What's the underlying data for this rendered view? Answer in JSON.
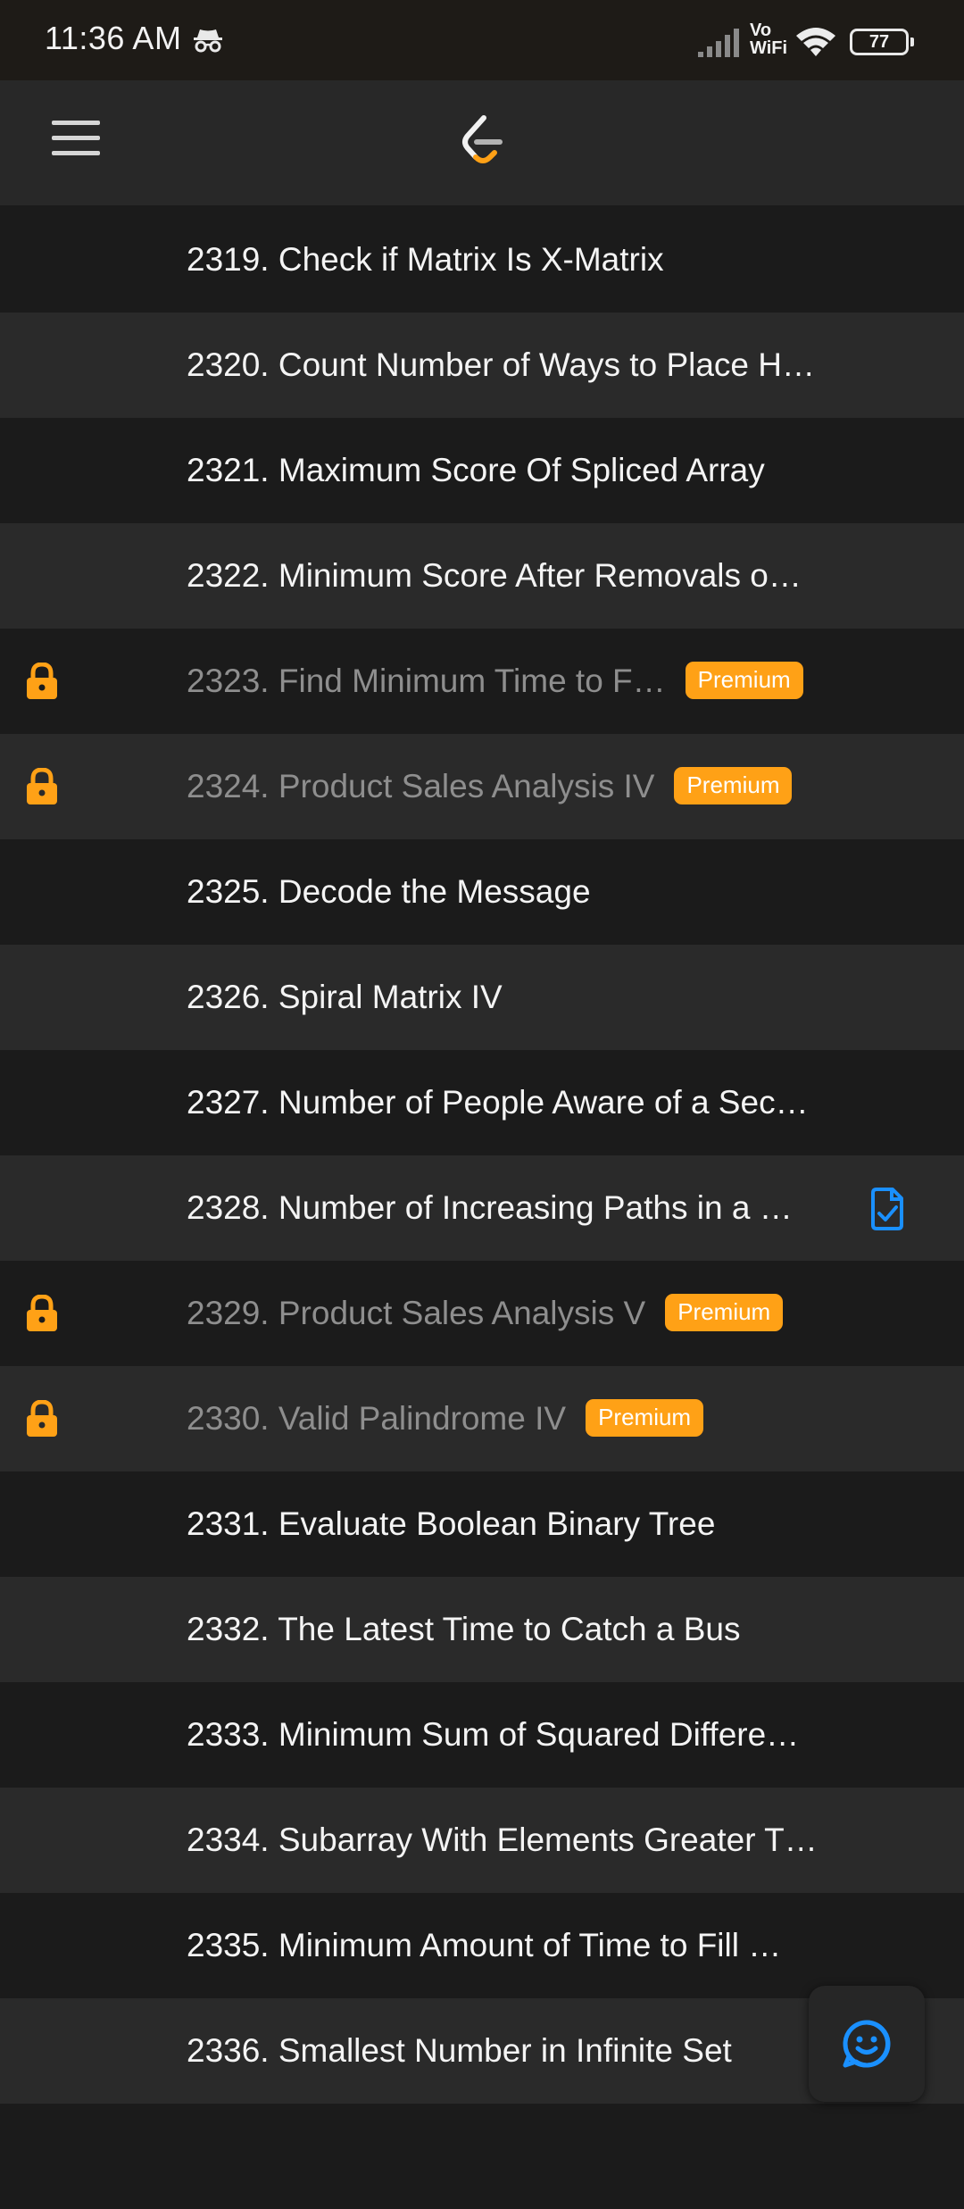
{
  "status_bar": {
    "time": "11:36 AM",
    "network_label_top": "Vo",
    "network_label_bottom": "WiFi",
    "battery": "77"
  },
  "header": {
    "menu_icon": "hamburger-menu-icon",
    "logo_icon": "leetcode-logo-icon"
  },
  "colors": {
    "premium_badge": "#ffa116",
    "lock": "#ffa116",
    "solved": "#1a90ff"
  },
  "problems": [
    {
      "title": "2319. Check if Matrix Is X-Matrix",
      "locked": false
    },
    {
      "title": "2320. Count Number of Ways to Place H…",
      "locked": false
    },
    {
      "title": "2321. Maximum Score Of Spliced Array",
      "locked": false
    },
    {
      "title": "2322. Minimum Score After Removals o…",
      "locked": false
    },
    {
      "title": "2323. Find Minimum Time to F…",
      "locked": true,
      "badge": "Premium"
    },
    {
      "title": "2324. Product Sales Analysis IV",
      "locked": true,
      "badge": "Premium"
    },
    {
      "title": "2325. Decode the Message",
      "locked": false
    },
    {
      "title": "2326. Spiral Matrix IV",
      "locked": false
    },
    {
      "title": "2327. Number of People Aware of a Sec…",
      "locked": false
    },
    {
      "title": "2328. Number of Increasing Paths in a …",
      "locked": false,
      "solved": true
    },
    {
      "title": "2329. Product Sales Analysis V",
      "locked": true,
      "badge": "Premium"
    },
    {
      "title": "2330. Valid Palindrome IV",
      "locked": true,
      "badge": "Premium"
    },
    {
      "title": "2331. Evaluate Boolean Binary Tree",
      "locked": false
    },
    {
      "title": "2332. The Latest Time to Catch a Bus",
      "locked": false
    },
    {
      "title": "2333. Minimum Sum of Squared Differe…",
      "locked": false
    },
    {
      "title": "2334. Subarray With Elements Greater T…",
      "locked": false
    },
    {
      "title": "2335. Minimum Amount of Time to Fill …",
      "locked": false
    },
    {
      "title": "2336. Smallest Number in Infinite Set",
      "locked": false
    }
  ],
  "fab": {
    "icon": "feedback-smiley-icon"
  }
}
